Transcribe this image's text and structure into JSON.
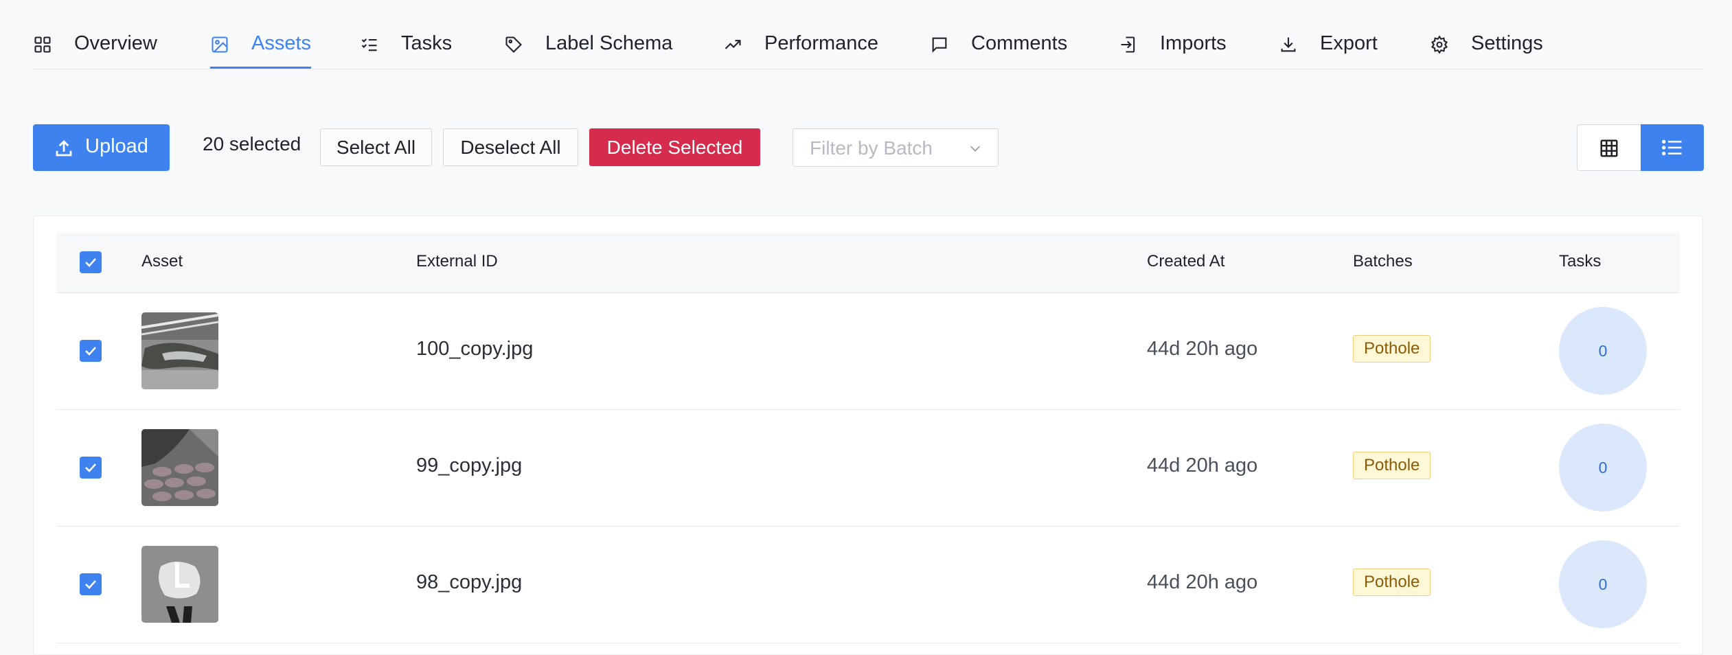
{
  "tabs": [
    {
      "label": "Overview",
      "icon": "grid-icon"
    },
    {
      "label": "Assets",
      "icon": "image-icon",
      "active": true
    },
    {
      "label": "Tasks",
      "icon": "checklist-icon"
    },
    {
      "label": "Label Schema",
      "icon": "tag-icon"
    },
    {
      "label": "Performance",
      "icon": "trending-up-icon"
    },
    {
      "label": "Comments",
      "icon": "comment-icon"
    },
    {
      "label": "Imports",
      "icon": "import-icon"
    },
    {
      "label": "Export",
      "icon": "download-icon"
    },
    {
      "label": "Settings",
      "icon": "gear-icon"
    }
  ],
  "toolbar": {
    "upload_label": "Upload",
    "selected_count": "20 selected",
    "select_all_label": "Select All",
    "deselect_all_label": "Deselect All",
    "delete_selected_label": "Delete Selected",
    "filter_placeholder": "Filter by Batch",
    "view_mode": "list"
  },
  "table": {
    "columns": [
      "Asset",
      "External ID",
      "Created At",
      "Batches",
      "Tasks"
    ],
    "all_selected": true,
    "rows": [
      {
        "selected": true,
        "thumbnail": "pothole-photo-1",
        "external_id": "100_copy.jpg",
        "created_at": "44d 20h ago",
        "batch": "Pothole",
        "tasks": "0"
      },
      {
        "selected": true,
        "thumbnail": "pothole-photo-2",
        "external_id": "99_copy.jpg",
        "created_at": "44d 20h ago",
        "batch": "Pothole",
        "tasks": "0"
      },
      {
        "selected": true,
        "thumbnail": "pothole-photo-3",
        "external_id": "98_copy.jpg",
        "created_at": "44d 20h ago",
        "batch": "Pothole",
        "tasks": "0"
      }
    ]
  },
  "colors": {
    "primary": "#3d82ee",
    "danger": "#d52b4c",
    "badge_bg": "#fff8d6",
    "badge_border": "#f1cf7c",
    "task_circle_bg": "#dbe8fc"
  }
}
